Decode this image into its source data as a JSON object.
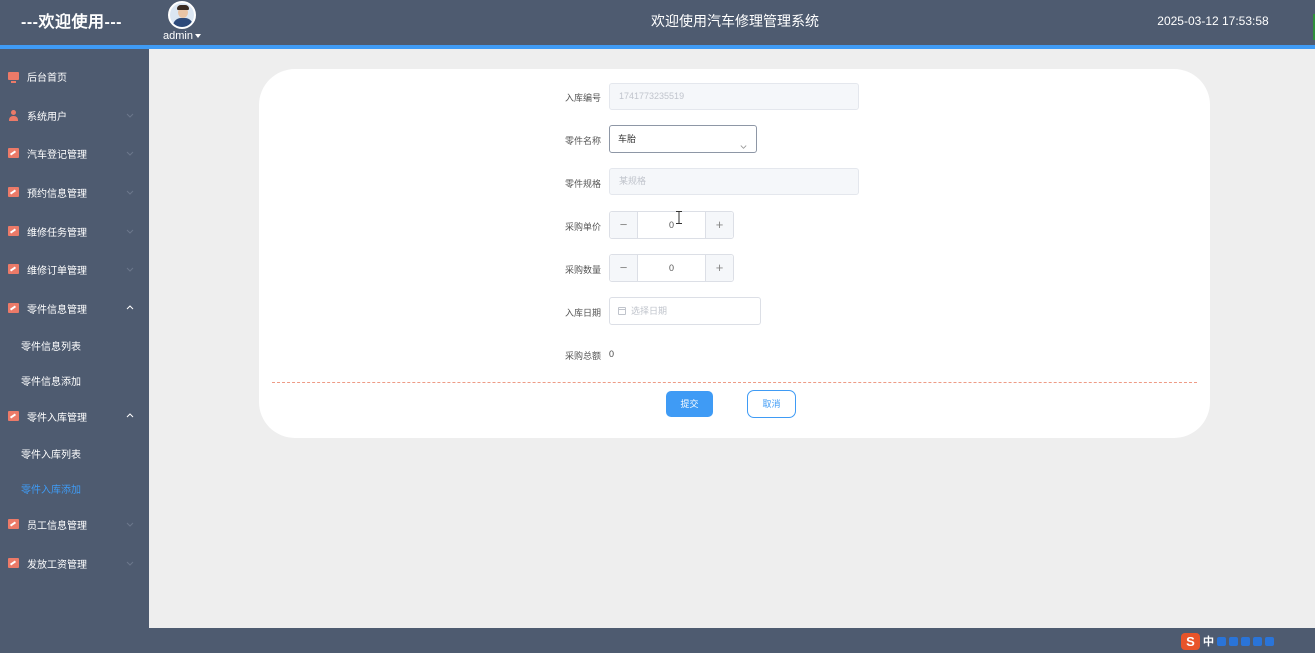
{
  "header": {
    "brand": "---欢迎使用---",
    "user": "admin",
    "system_title": "欢迎使用汽车修理管理系统",
    "datetime": "2025-03-12 17:53:58"
  },
  "sidebar": {
    "items": [
      {
        "label": "后台首页",
        "icon": "monitor-icon"
      },
      {
        "label": "系统用户",
        "icon": "user-icon",
        "expanded": false
      },
      {
        "label": "汽车登记管理",
        "icon": "chart-icon",
        "expanded": false
      },
      {
        "label": "预约信息管理",
        "icon": "chart-icon",
        "expanded": false
      },
      {
        "label": "维修任务管理",
        "icon": "chart-icon",
        "expanded": false
      },
      {
        "label": "维修订单管理",
        "icon": "chart-icon",
        "expanded": false
      },
      {
        "label": "零件信息管理",
        "icon": "chart-icon",
        "expanded": true,
        "children": [
          "零件信息列表",
          "零件信息添加"
        ]
      },
      {
        "label": "零件入库管理",
        "icon": "chart-icon",
        "expanded": true,
        "children": [
          "零件入库列表",
          "零件入库添加"
        ],
        "active_child": "零件入库添加"
      },
      {
        "label": "员工信息管理",
        "icon": "chart-icon",
        "expanded": false
      },
      {
        "label": "发放工资管理",
        "icon": "chart-icon",
        "expanded": false
      }
    ]
  },
  "form": {
    "stock_in_no": {
      "label": "入库编号",
      "value": "1741773235519"
    },
    "part_name": {
      "label": "零件名称",
      "value": "车胎"
    },
    "part_spec": {
      "label": "零件规格",
      "placeholder": "某规格"
    },
    "unit_price": {
      "label": "采购单价",
      "value": "0"
    },
    "quantity": {
      "label": "采购数量",
      "value": "0"
    },
    "stock_in_date": {
      "label": "入库日期",
      "placeholder": "选择日期"
    },
    "total": {
      "label": "采购总额",
      "value": "0"
    },
    "submit_label": "提交",
    "cancel_label": "取消"
  },
  "colors": {
    "header_bg": "#4e5b70",
    "accent": "#3f9bf5",
    "icon": "#ec7a68",
    "content_bg": "#eeeeee"
  },
  "ime": {
    "logo": "S",
    "mode": "中"
  }
}
